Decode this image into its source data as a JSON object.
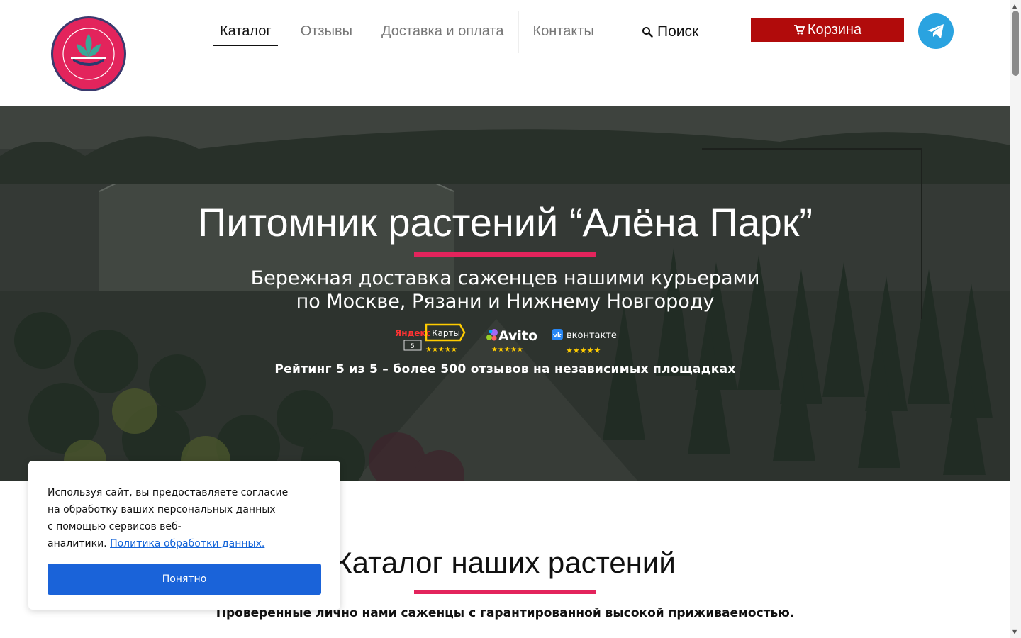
{
  "header": {
    "logo": {
      "top_text": "АЛЁНА ПАРК",
      "bottom_text": "ПИТОМНИК РАСТЕНИЙ",
      "color": "#e3245c"
    },
    "nav": [
      {
        "label": "Каталог",
        "active": true
      },
      {
        "label": "Отзывы",
        "active": false
      },
      {
        "label": "Доставка и оплата",
        "active": false
      },
      {
        "label": "Контакты",
        "active": false
      }
    ],
    "search_label": "Поиск",
    "cart_label": "Корзина",
    "cart_color": "#b10b0b",
    "telegram_color": "#2aa3e0"
  },
  "hero": {
    "title": "Питомник растений “Алёна Парк”",
    "subtitle_line1": "Бережная доставка саженцев нашими курьерами",
    "subtitle_line2": "по Москве, Рязани и Нижнему Новгороду",
    "badges": [
      {
        "name": "yandex-maps",
        "brand": "Яндекс",
        "label": "Карты",
        "score": "5",
        "stars": 5
      },
      {
        "name": "avito",
        "label": "Avito",
        "stars": 5
      },
      {
        "name": "vkontakte",
        "label": "вконтакте",
        "stars": 5
      }
    ],
    "rating_text": "Рейтинг 5 из 5 – более 500 отзывов на независимых площадках",
    "accent_color": "#e3245c"
  },
  "catalog": {
    "title": "Каталог наших растений",
    "subtitle": "Проверенные лично нами саженцы с гарантированной высокой приживаемостью."
  },
  "cookie": {
    "line1": "Используя сайт, вы предоставляете согласие",
    "line2": "на обработку ваших персональных данных",
    "line3": "с помощью сервисов веб-",
    "line4": "аналитики.",
    "link_text": "Политика обработки данных.",
    "button_label": "Понятно",
    "button_color": "#1a63d9"
  }
}
